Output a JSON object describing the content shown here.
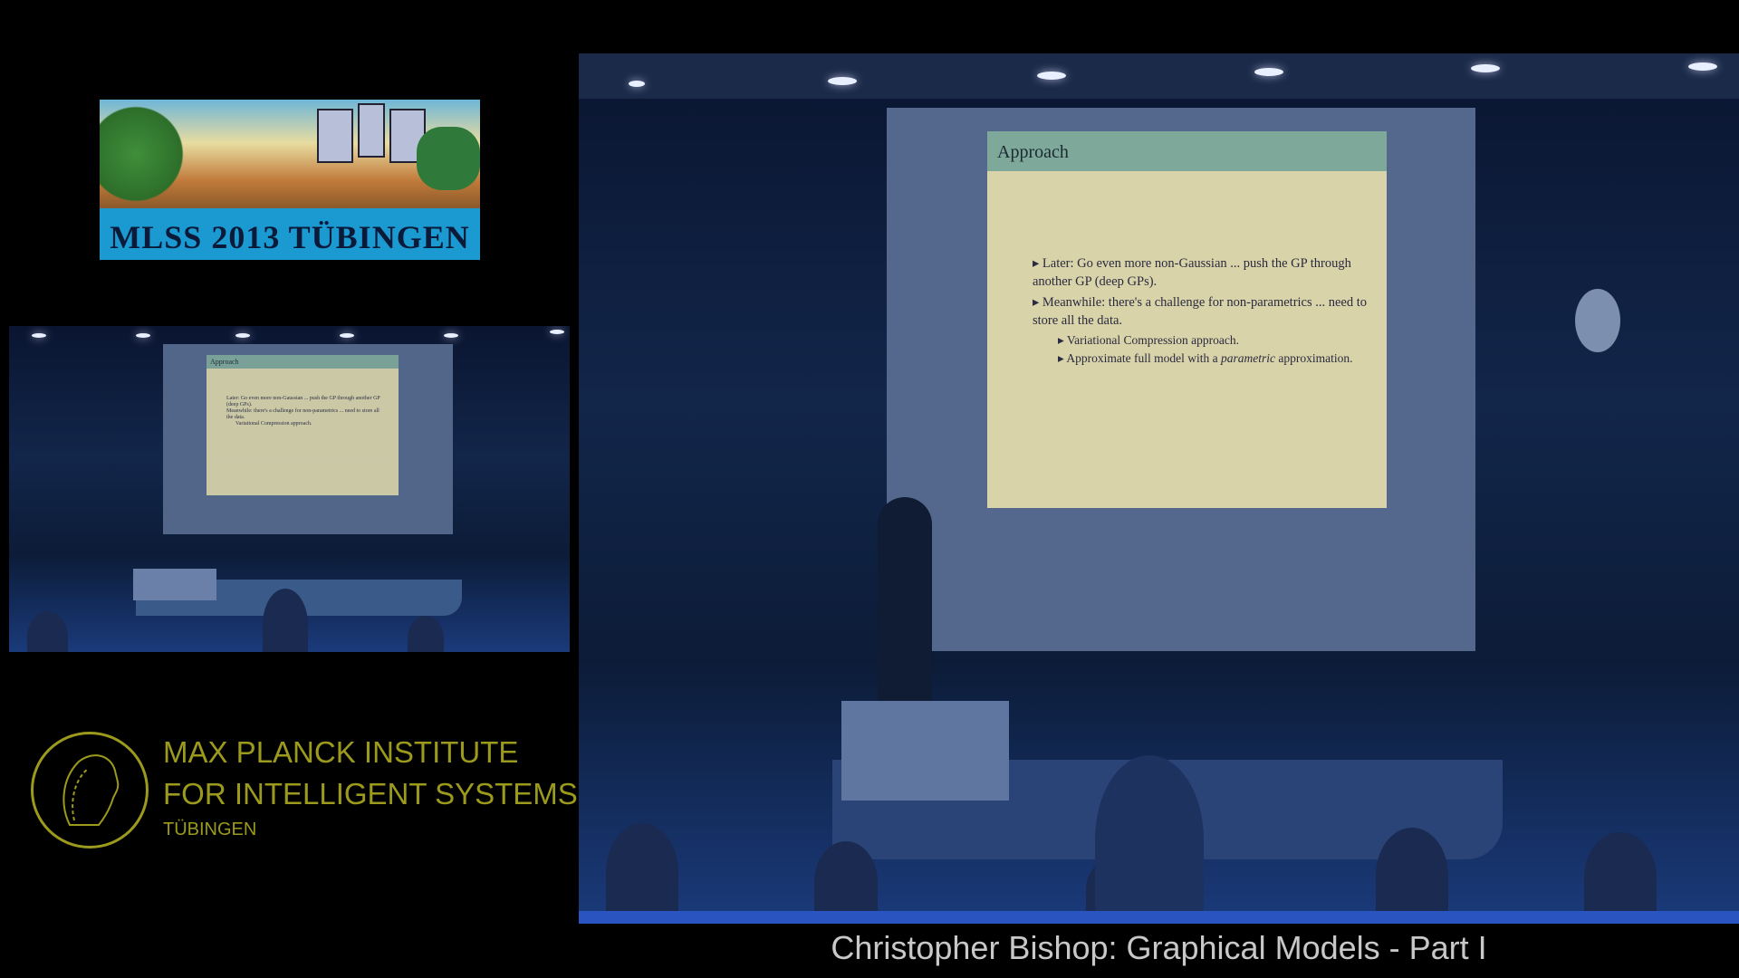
{
  "header_logo": {
    "title": "MLSS 2013 TÜBINGEN"
  },
  "slide": {
    "title": "Approach",
    "bullets": [
      {
        "text": "Later: Go even more non-Gaussian ... push the GP through another GP (deep GPs)."
      },
      {
        "text": "Meanwhile: there's a challenge for non-parametrics ... need to store all the data."
      }
    ],
    "sub_bullets": [
      {
        "text": "Variational Compression approach."
      },
      {
        "pre": "Approximate full model with a ",
        "em": "parametric",
        "post": " approximation."
      }
    ]
  },
  "institute": {
    "line1": "MAX PLANCK INSTITUTE",
    "line2": "FOR INTELLIGENT SYSTEMS",
    "line3": "TÜBINGEN"
  },
  "caption": "Christopher Bishop: Graphical Models - Part I",
  "colors": {
    "institute": "#9c9a1c",
    "slide_header": "#7ea89a",
    "slide_bg": "#d8d3a8"
  }
}
